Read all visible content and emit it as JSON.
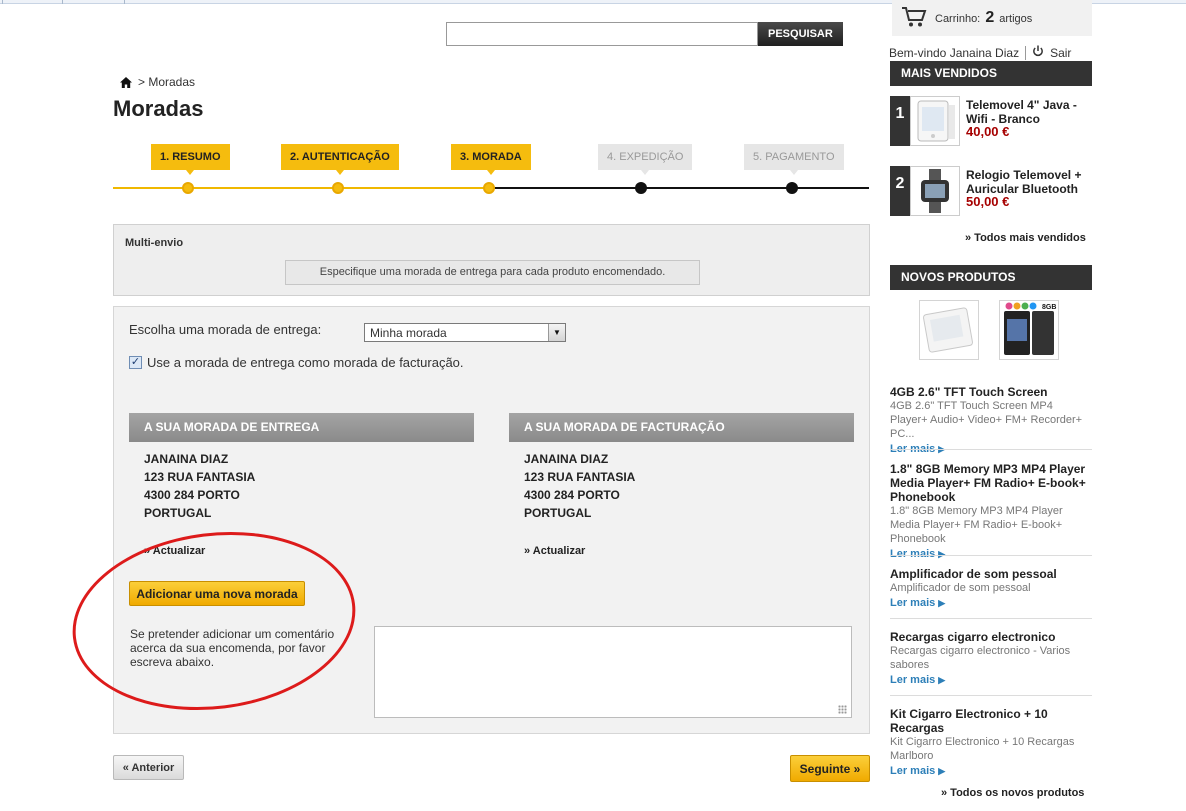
{
  "search": {
    "placeholder": "",
    "button_label": "PESQUISAR"
  },
  "cart": {
    "label": "Carrinho:",
    "count": "2",
    "unit": "artigos"
  },
  "user": {
    "welcome": "Bem-vindo Janaina Diaz",
    "logout": "Sair"
  },
  "breadcrumb": {
    "current": "> Moradas"
  },
  "page_title": "Moradas",
  "steps": [
    {
      "label": "1. RESUMO",
      "state": "done"
    },
    {
      "label": "2. AUTENTICAÇÃO",
      "state": "done"
    },
    {
      "label": "3. MORADA",
      "state": "done"
    },
    {
      "label": "4. EXPEDIÇÃO",
      "state": "todo"
    },
    {
      "label": "5. PAGAMENTO",
      "state": "todo"
    }
  ],
  "multi_envio": {
    "title": "Multi-envio",
    "hint": "Especifique uma morada de entrega para cada produto encomendado."
  },
  "address_form": {
    "choose_label": "Escolha uma morada de entrega:",
    "selected_address": "Minha morada",
    "same_billing_label": "Use a morada de entrega como morada de facturação.",
    "same_billing_checked": true,
    "delivery": {
      "title": "A SUA MORADA DE ENTREGA",
      "lines": [
        "JANAINA DIAZ",
        "123 RUA FANTASIA",
        "4300 284 PORTO",
        "PORTUGAL"
      ],
      "update": "» Actualizar"
    },
    "billing": {
      "title": "A SUA MORADA DE FACTURAÇÃO",
      "lines": [
        "JANAINA DIAZ",
        "123 RUA FANTASIA",
        "4300 284 PORTO",
        "PORTUGAL"
      ],
      "update": "» Actualizar"
    },
    "add_button": "Adicionar uma nova morada",
    "comment_hint": "Se pretender adicionar um comentário acerca da sua encomenda, por favor escreva abaixo.",
    "comment_value": ""
  },
  "nav": {
    "prev": "« Anterior",
    "next": "Seguinte »"
  },
  "best_sellers": {
    "title": "MAIS VENDIDOS",
    "items": [
      {
        "rank": "1",
        "name": "Telemovel 4\" Java - Wifi - Branco",
        "price": "40,00 €"
      },
      {
        "rank": "2",
        "name": "Relogio Telemovel + Auricular Bluetooth",
        "price": "50,00 €"
      }
    ],
    "all_link": "» Todos mais vendidos"
  },
  "new_products": {
    "title": "NOVOS PRODUTOS",
    "more_label": "Ler mais",
    "items": [
      {
        "title": "4GB 2.6\" TFT Touch Screen",
        "desc": "4GB 2.6\" TFT Touch Screen MP4 Player+ Audio+ Video+ FM+ Recorder+ PC..."
      },
      {
        "title": "1.8\" 8GB Memory MP3 MP4 Player Media Player+ FM Radio+ E-book+ Phonebook",
        "desc": "1.8\" 8GB Memory MP3 MP4 Player Media Player+ FM Radio+ E-book+ Phonebook"
      },
      {
        "title": "Amplificador de som pessoal",
        "desc": "Amplificador de som pessoal"
      },
      {
        "title": "Recargas cigarro electronico",
        "desc": "Recargas cigarro electronico - Varios sabores"
      },
      {
        "title": "Kit Cigarro Electronico + 10 Recargas",
        "desc": "Kit Cigarro Electronico + 10 Recargas Marlboro"
      }
    ],
    "all_link": "» Todos os novos produtos"
  },
  "colors": {
    "accent": "#f5bc0e",
    "dark": "#333333",
    "price": "#a60000",
    "link": "#2d7fb8",
    "annotation": "#dd1b1b"
  }
}
